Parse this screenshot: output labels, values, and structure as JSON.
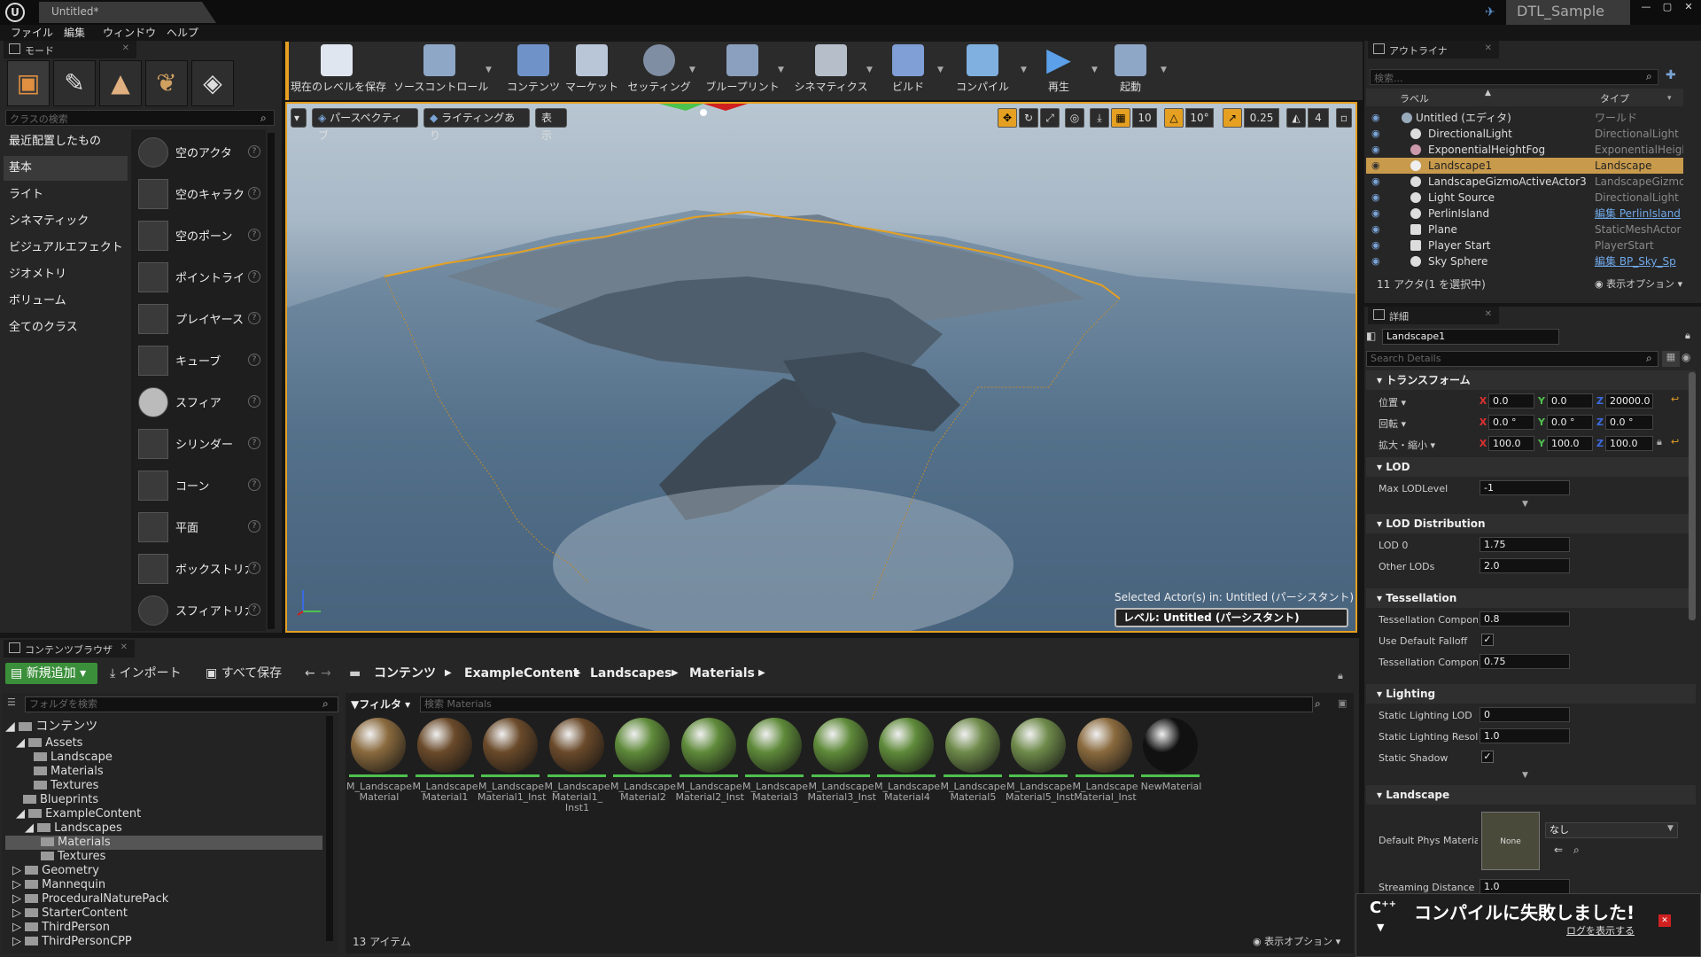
{
  "window": {
    "tab_title": "Untitled*",
    "project_name": "DTL_Sample",
    "controls": [
      "—",
      "▢",
      "✕"
    ]
  },
  "menu": [
    "ファイル",
    "編集",
    "ウィンドウ",
    "ヘルプ"
  ],
  "modes": {
    "tab": "モード",
    "search_placeholder": "クラスの検索",
    "categories": [
      "最近配置したもの",
      "基本",
      "ライト",
      "シネマティック",
      "ビジュアルエフェクト",
      "ジオメトリ",
      "ボリューム",
      "全てのクラス"
    ],
    "selected_category": "基本",
    "items": [
      "空のアクタ",
      "空のキャラク",
      "空のポーン",
      "ポイントライト",
      "プレイヤース",
      "キューブ",
      "スフィア",
      "シリンダー",
      "コーン",
      "平面",
      "ボックストリガ",
      "スフィアトリガ"
    ]
  },
  "toolbar": {
    "buttons": [
      "現在のレベルを保存",
      "ソースコントロール",
      "コンテンツ",
      "マーケット",
      "セッティング",
      "ブループリント",
      "シネマティクス",
      "ビルド",
      "コンパイル",
      "再生",
      "起動"
    ]
  },
  "viewport": {
    "view_mode": "パースペクティブ",
    "lighting": "ライティングあり",
    "show": "表示",
    "grid_snap": "10",
    "rot_snap": "10°",
    "scale_snap": "0.25",
    "cam_speed": "4",
    "selected_info": "Selected Actor(s) in:  Untitled (パーシスタント)",
    "level": "レベル:  Untitled (パーシスタント)"
  },
  "outliner": {
    "tab": "アウトライナ",
    "search_placeholder": "検索...",
    "col_label": "ラベル",
    "col_type": "タイプ",
    "rows": [
      {
        "label": "Untitled (エディタ)",
        "type": "ワールド",
        "icon": "world-icon"
      },
      {
        "label": "DirectionalLight",
        "type": "DirectionalLight",
        "icon": "sun-icon"
      },
      {
        "label": "ExponentialHeightFog",
        "type": "ExponentialHeigh",
        "icon": "fog-icon"
      },
      {
        "label": "Landscape1",
        "type": "Landscape",
        "icon": "landscape-icon",
        "selected": true
      },
      {
        "label": "LandscapeGizmoActiveActor3",
        "type": "LandscapeGizmo",
        "icon": "sphere-icon"
      },
      {
        "label": "Light Source",
        "type": "DirectionalLight",
        "icon": "sun-icon"
      },
      {
        "label": "PerlinIsland",
        "type": "編集 PerlinIsland",
        "icon": "sphere-icon",
        "link": true
      },
      {
        "label": "Plane",
        "type": "StaticMeshActor",
        "icon": "mesh-icon"
      },
      {
        "label": "Player Start",
        "type": "PlayerStart",
        "icon": "player-icon"
      },
      {
        "label": "Sky Sphere",
        "type": "編集 BP_Sky_Sp",
        "icon": "sphere-icon",
        "link": true
      }
    ],
    "footer": "11 アクタ(1 を選択中)",
    "view_options": "表示オプション"
  },
  "details": {
    "tab": "詳細",
    "name": "Landscape1",
    "search_placeholder": "Search Details",
    "sections": {
      "transform": "トランスフォーム",
      "lod": "LOD",
      "lod_dist": "LOD Distribution",
      "tess": "Tessellation",
      "lighting": "Lighting",
      "landscape": "Landscape"
    },
    "transform": {
      "location_label": "位置",
      "rotation_label": "回転",
      "scale_label": "拡大・縮小",
      "location": [
        "0.0",
        "0.0",
        "20000.0"
      ],
      "rotation": [
        "0.0 °",
        "0.0 °",
        "0.0 °"
      ],
      "scale": [
        "100.0",
        "100.0",
        "100.0"
      ]
    },
    "props": {
      "max_lod_label": "Max LODLevel",
      "max_lod": "-1",
      "lod0_label": "LOD 0",
      "lod0": "1.75",
      "other_lods_label": "Other LODs",
      "other_lods": "2.0",
      "tess_comp_label": "Tessellation Compone",
      "tess_comp": "0.8",
      "use_falloff_label": "Use Default Falloff",
      "tess_comp2_label": "Tessellation Compone",
      "tess_comp2": "0.75",
      "static_lod_label": "Static Lighting LOD",
      "static_lod": "0",
      "static_res_label": "Static Lighting Resolu",
      "static_res": "1.0",
      "static_shadow_label": "Static Shadow",
      "phys_mat_label": "Default Phys Material",
      "phys_mat_thumb": "None",
      "phys_mat_value": "なし",
      "stream_label": "Streaming Distance M",
      "stream": "1.0"
    }
  },
  "content_browser": {
    "tab": "コンテンツブラウザ",
    "add_new": "新規追加",
    "import": "インポート",
    "save_all": "すべて保存",
    "breadcrumb": [
      "コンテンツ",
      "ExampleContent",
      "Landscapes",
      "Materials"
    ],
    "folder_search_placeholder": "フォルダを検索",
    "filter": "フィルタ",
    "asset_search_placeholder": "検索 Materials",
    "tree": [
      {
        "label": "コンテンツ",
        "depth": 0
      },
      {
        "label": "Assets",
        "depth": 1
      },
      {
        "label": "Landscape",
        "depth": 2
      },
      {
        "label": "Materials",
        "depth": 2
      },
      {
        "label": "Textures",
        "depth": 2
      },
      {
        "label": "Blueprints",
        "depth": 1
      },
      {
        "label": "ExampleContent",
        "depth": 1
      },
      {
        "label": "Landscapes",
        "depth": 2
      },
      {
        "label": "Materials",
        "depth": 3,
        "selected": true
      },
      {
        "label": "Textures",
        "depth": 3
      },
      {
        "label": "Geometry",
        "depth": 1
      },
      {
        "label": "Mannequin",
        "depth": 1
      },
      {
        "label": "ProceduralNaturePack",
        "depth": 1
      },
      {
        "label": "StarterContent",
        "depth": 1
      },
      {
        "label": "ThirdPerson",
        "depth": 1
      },
      {
        "label": "ThirdPersonCPP",
        "depth": 1
      }
    ],
    "assets": [
      {
        "name": "M_Landscape\nMaterial",
        "color": "#8a6a3e"
      },
      {
        "name": "M_Landscape\nMaterial1",
        "color": "#6a4a2a"
      },
      {
        "name": "M_Landscape\nMaterial1_Inst",
        "color": "#6a4a2a"
      },
      {
        "name": "M_Landscape\nMaterial1_\nInst1",
        "color": "#6a4a2a"
      },
      {
        "name": "M_Landscape\nMaterial2",
        "color": "#5f8a3a"
      },
      {
        "name": "M_Landscape\nMaterial2_Inst",
        "color": "#5f8a3a"
      },
      {
        "name": "M_Landscape\nMaterial3",
        "color": "#5f8a3a"
      },
      {
        "name": "M_Landscape\nMaterial3_Inst",
        "color": "#5f8a3a"
      },
      {
        "name": "M_Landscape\nMaterial4",
        "color": "#5f8a3a"
      },
      {
        "name": "M_Landscape\nMaterial5",
        "color": "#6e8a4a"
      },
      {
        "name": "M_Landscape\nMaterial5_Inst",
        "color": "#6e8a4a"
      },
      {
        "name": "M_Landscape\nMaterial_Inst",
        "color": "#8a6a3e"
      },
      {
        "name": "NewMaterial",
        "color": "#111111"
      }
    ],
    "count": "13 アイテム",
    "view_options": "表示オプション"
  },
  "toast": {
    "title": "コンパイルに失敗しました!",
    "link": "ログを表示する"
  },
  "colors": {
    "accent": "#e5a021",
    "selection": "#c79a4c",
    "green": "#4ec24e",
    "error": "#d02020"
  }
}
